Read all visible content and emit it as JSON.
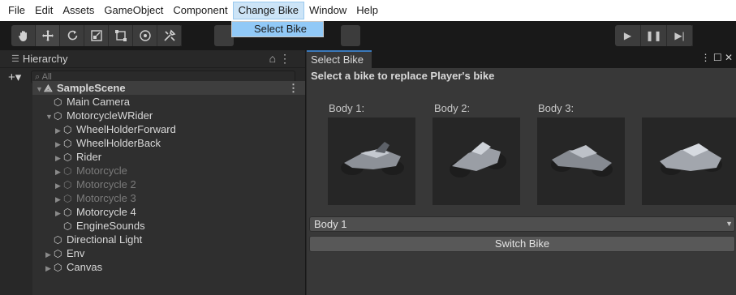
{
  "menubar": {
    "items": [
      "File",
      "Edit",
      "Assets",
      "GameObject",
      "Component",
      "Change Bike",
      "Window",
      "Help"
    ],
    "active_index": 5
  },
  "dropdown": {
    "items": [
      "Select Bike"
    ]
  },
  "hierarchy": {
    "tab_label": "Hierarchy",
    "search_placeholder": "All",
    "rows": [
      {
        "label": "SampleScene",
        "indent": 0,
        "arrow": "▼",
        "icon": "scene",
        "style": "scene"
      },
      {
        "label": "Main Camera",
        "indent": 1,
        "arrow": "",
        "icon": "cube",
        "style": ""
      },
      {
        "label": "MotorcycleWRider",
        "indent": 1,
        "arrow": "▼",
        "icon": "cube",
        "style": ""
      },
      {
        "label": "WheelHolderForward",
        "indent": 2,
        "arrow": "▶",
        "icon": "cube",
        "style": ""
      },
      {
        "label": "WheelHolderBack",
        "indent": 2,
        "arrow": "▶",
        "icon": "cube",
        "style": ""
      },
      {
        "label": "Rider",
        "indent": 2,
        "arrow": "▶",
        "icon": "cube",
        "style": ""
      },
      {
        "label": "Motorcycle",
        "indent": 2,
        "arrow": "▶",
        "icon": "cube",
        "style": "dim"
      },
      {
        "label": "Motorcycle 2",
        "indent": 2,
        "arrow": "▶",
        "icon": "cube",
        "style": "dim"
      },
      {
        "label": "Motorcycle 3",
        "indent": 2,
        "arrow": "▶",
        "icon": "cube",
        "style": "dim"
      },
      {
        "label": "Motorcycle 4",
        "indent": 2,
        "arrow": "▶",
        "icon": "cube",
        "style": ""
      },
      {
        "label": "EngineSounds",
        "indent": 2,
        "arrow": "",
        "icon": "cube",
        "style": ""
      },
      {
        "label": "Directional Light",
        "indent": 1,
        "arrow": "",
        "icon": "cube",
        "style": ""
      },
      {
        "label": "Env",
        "indent": 1,
        "arrow": "▶",
        "icon": "cube",
        "style": ""
      },
      {
        "label": "Canvas",
        "indent": 1,
        "arrow": "▶",
        "icon": "cube",
        "style": ""
      }
    ]
  },
  "select_bike_window": {
    "tab_label": "Select Bike",
    "title": "Select a bike to replace Player's bike",
    "bodies": [
      {
        "label": "Body 1:"
      },
      {
        "label": "Body 2:"
      },
      {
        "label": "Body 3:"
      },
      {
        "label": ""
      }
    ],
    "dropdown_value": "Body 1",
    "switch_button": "Switch Bike"
  },
  "colors": {
    "accent": "#3a79bb",
    "menu_highlight": "#cce4f7",
    "dropdown_highlight": "#91c9f7"
  }
}
